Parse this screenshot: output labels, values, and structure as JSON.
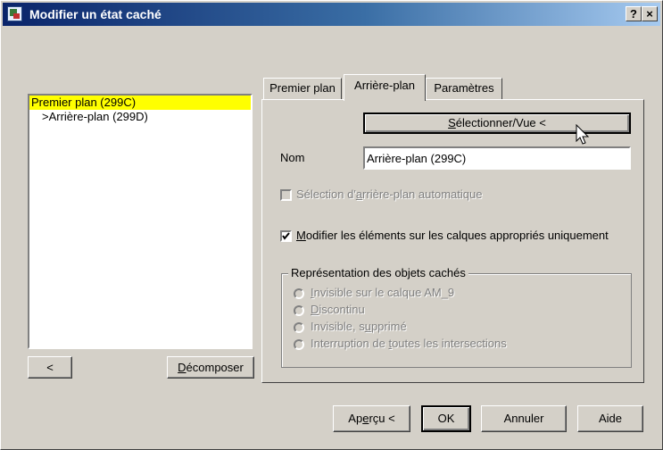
{
  "window": {
    "title": "Modifier un état caché"
  },
  "titlebar_buttons": {
    "help": "?",
    "close": "×"
  },
  "tree": {
    "items": [
      {
        "label": "Premier plan (299C)",
        "selected": true
      },
      {
        "label": ">Arrière-plan (299D)",
        "selected": false
      }
    ]
  },
  "left_buttons": {
    "back": "<",
    "decompose_pre": "",
    "decompose_u": "D",
    "decompose_post": "écomposer"
  },
  "tabs": [
    {
      "label": "Premier plan"
    },
    {
      "label": "Arrière-plan",
      "active": true
    },
    {
      "label": "Paramètres"
    }
  ],
  "panel": {
    "select_view": {
      "u": "S",
      "rest": "électionner/Vue  <"
    },
    "name_label": "Nom",
    "name_value": "Arrière-plan (299C)",
    "auto_select": {
      "pre": "Sélection d'",
      "u": "a",
      "post": "rrière-plan automatique",
      "checked": false,
      "enabled": false
    },
    "modify_only": {
      "u": "M",
      "post": "odifier les éléments sur les calques appropriés uniquement",
      "checked": true,
      "enabled": true
    },
    "group_title": "Représentation des objets cachés",
    "radios": [
      {
        "pre": "",
        "u": "I",
        "post": "nvisible sur le calque AM_9"
      },
      {
        "pre": "",
        "u": "D",
        "post": "iscontinu"
      },
      {
        "pre": "Invisible, s",
        "u": "u",
        "post": "pprimé"
      },
      {
        "pre": "Interruption de ",
        "u": "t",
        "post": "outes les intersections"
      }
    ]
  },
  "footer": {
    "preview": {
      "pre": "Ap",
      "u": "e",
      "post": "rçu <"
    },
    "ok": "OK",
    "cancel": "Annuler",
    "help": "Aide"
  }
}
